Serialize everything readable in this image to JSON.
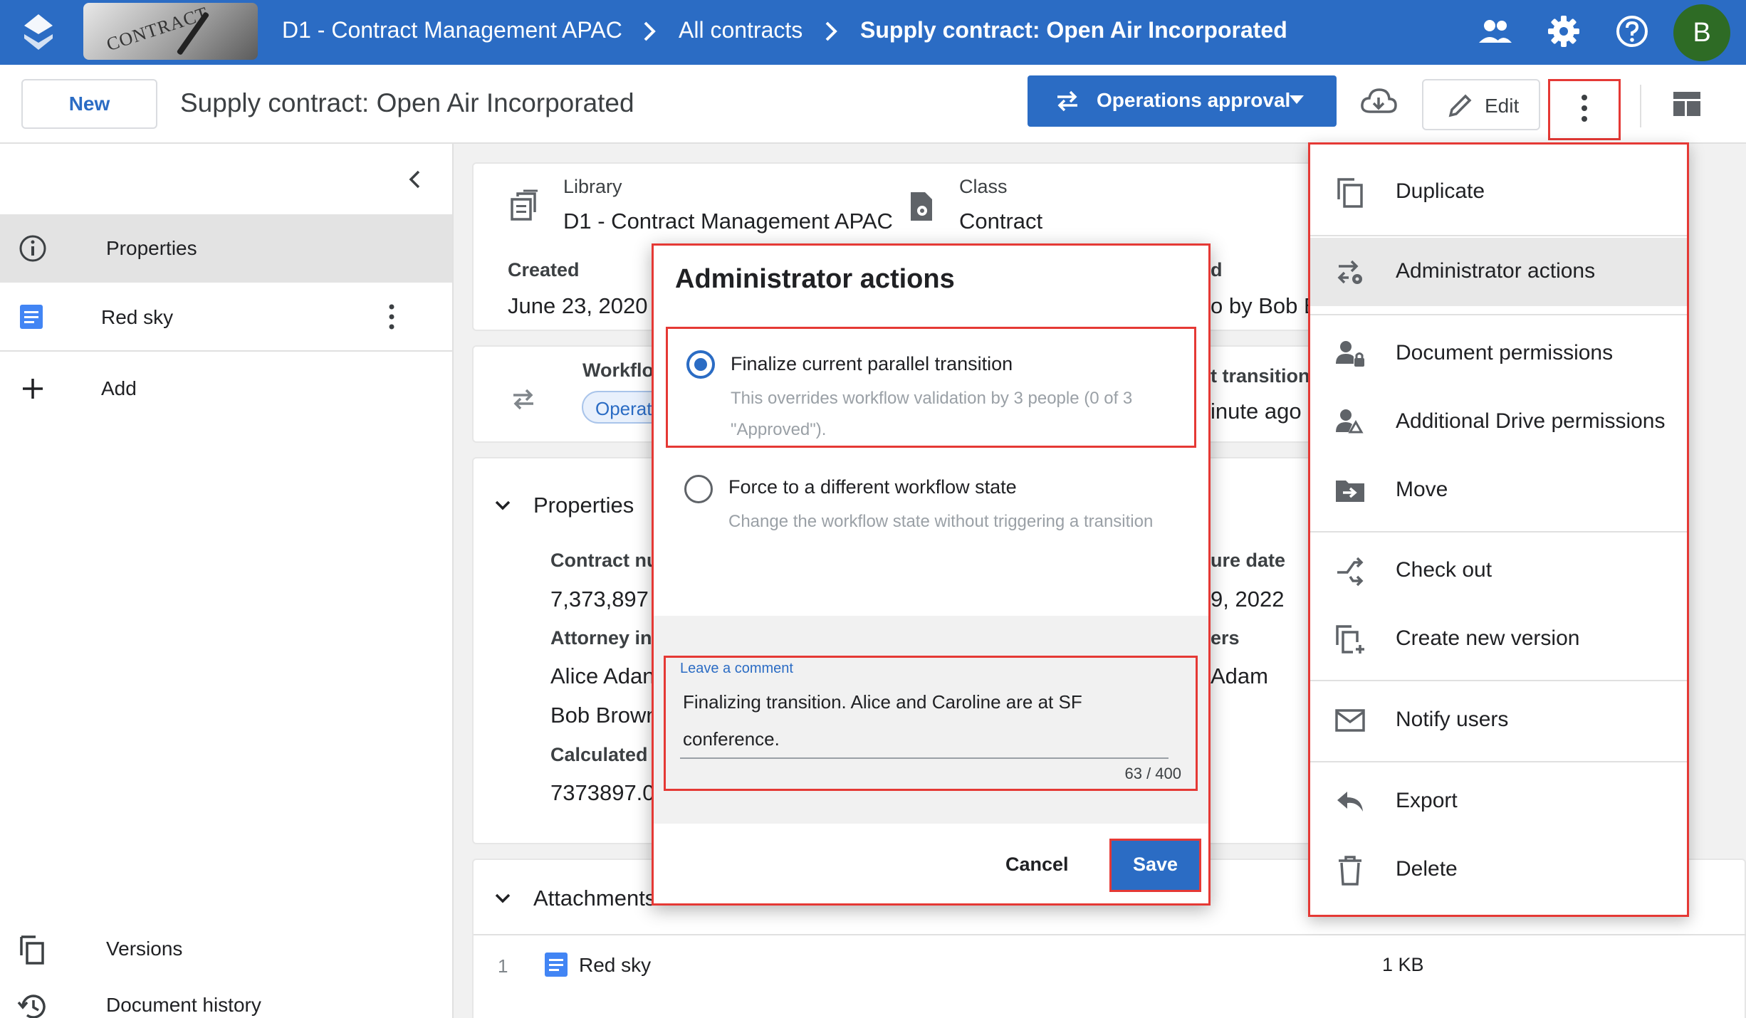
{
  "breadcrumb": {
    "library": "D1 - Contract Management APAC",
    "all": "All contracts",
    "current": "Supply contract: Open Air Incorporated"
  },
  "logo": {
    "text": "CONTRACT"
  },
  "user": {
    "initial": "B"
  },
  "toolbar": {
    "new_label": "New",
    "doc_title": "Supply contract: Open Air Incorporated",
    "workflow_label": "Operations approval",
    "edit_label": "Edit"
  },
  "sidebar": {
    "items": [
      {
        "label": "Properties"
      },
      {
        "label": "Red sky"
      },
      {
        "label": "Add"
      }
    ],
    "bottom": [
      {
        "label": "Versions"
      },
      {
        "label": "Document history"
      }
    ]
  },
  "info": {
    "library_label": "Library",
    "library_value": "D1 - Contract Management APAC",
    "class_label": "Class",
    "class_value": "Contract",
    "created_label": "Created",
    "created_value": "June 23, 2020 b",
    "modified_label_frag": "d",
    "modified_value_frag": "o by Bob B"
  },
  "workflow": {
    "label": "Workflo",
    "chip": "Operat",
    "transition_frag": "t transition",
    "time_frag": "inute ago b"
  },
  "properties": {
    "header": "Properties",
    "contract_num_label": "Contract nu",
    "contract_num_value": "7,373,897",
    "attorney_label": "Attorney in",
    "attorney_1": "Alice Adan",
    "attorney_2": "Bob Brown",
    "calculated_label": "Calculated",
    "calculated_value": "7373897.0",
    "date_label_frag": "ure date",
    "date_value_frag": "9, 2022",
    "ers_label_frag": "ers",
    "ers_value_frag": "Adam"
  },
  "attachments": {
    "header": "Attachments",
    "rows": [
      {
        "index": "1",
        "name": "Red sky",
        "size": "1 KB"
      }
    ]
  },
  "dialog": {
    "title": "Administrator actions",
    "option1_title": "Finalize current parallel transition",
    "option1_desc": "This overrides workflow validation by 3 people (0 of 3 \"Approved\").",
    "option2_title": "Force to a different workflow state",
    "option2_desc": "Change the workflow state without triggering a transition",
    "comment_label": "Leave a comment",
    "comment_value": "Finalizing transition. Alice and Caroline are at SF conference.",
    "counter": "63 / 400",
    "cancel": "Cancel",
    "save": "Save"
  },
  "menu": {
    "items": [
      {
        "label": "Duplicate",
        "icon": "copy-icon"
      },
      {
        "label": "Administrator actions",
        "icon": "admin-actions-icon"
      },
      {
        "label": "Document permissions",
        "icon": "person-lock-icon"
      },
      {
        "label": "Additional Drive permissions",
        "icon": "drive-person-icon"
      },
      {
        "label": "Move",
        "icon": "move-folder-icon"
      },
      {
        "label": "Check out",
        "icon": "check-out-icon"
      },
      {
        "label": "Create new version",
        "icon": "new-version-icon"
      },
      {
        "label": "Notify users",
        "icon": "mail-icon"
      },
      {
        "label": "Export",
        "icon": "export-icon"
      },
      {
        "label": "Delete",
        "icon": "trash-icon"
      }
    ]
  },
  "colors": {
    "brand": "#2b6cc4",
    "highlight": "#e53935",
    "avatar": "#2e7d32"
  }
}
